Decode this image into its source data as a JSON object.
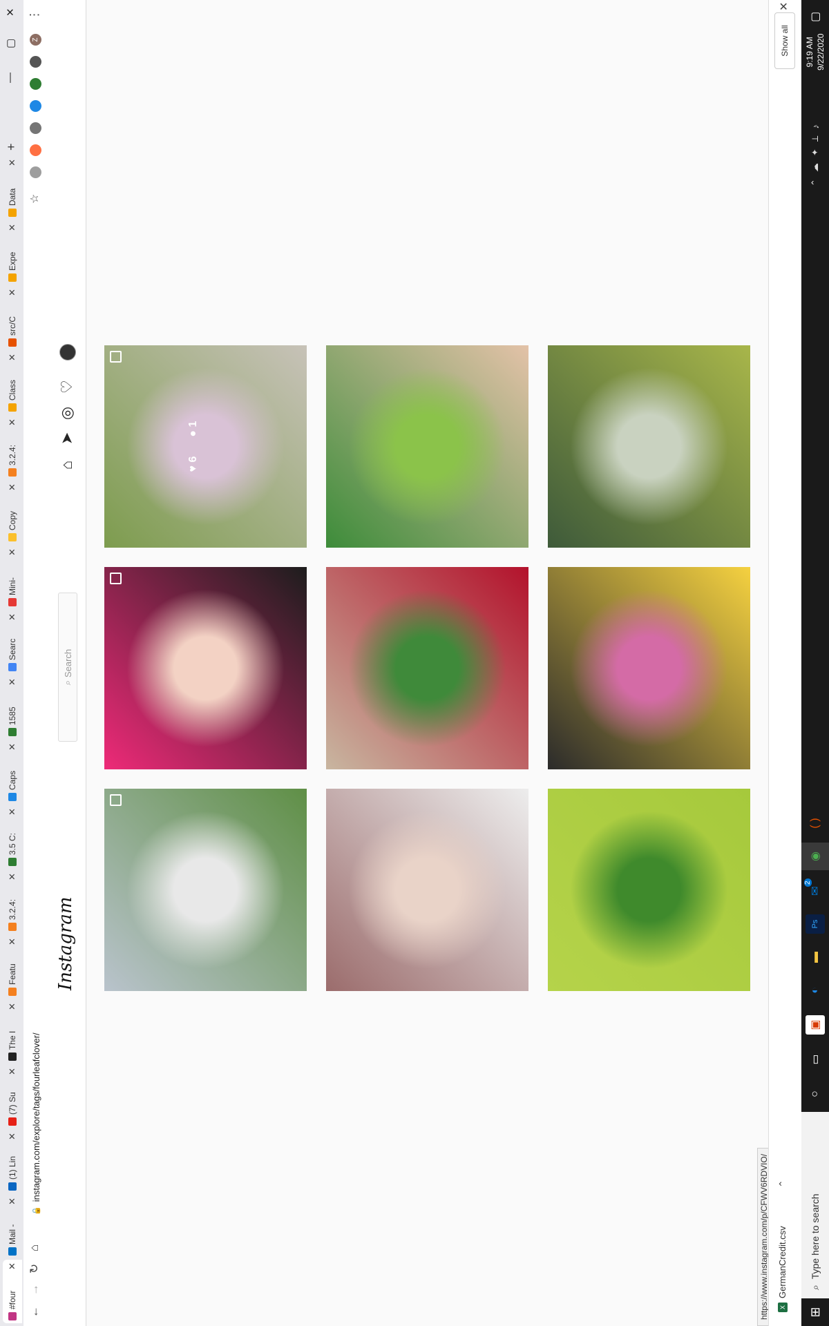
{
  "browser": {
    "tabs": [
      {
        "title": "#four",
        "favicon_color": "#c13584",
        "active": true
      },
      {
        "title": "Mail -",
        "favicon_color": "#0072c6"
      },
      {
        "title": "(1) Lin",
        "favicon_color": "#0a66c2"
      },
      {
        "title": "(7) Su",
        "favicon_color": "#e62117"
      },
      {
        "title": "The I",
        "favicon_color": "#222222"
      },
      {
        "title": "Featu",
        "favicon_color": "#f4801f"
      },
      {
        "title": "3.2.4:",
        "favicon_color": "#f4801f"
      },
      {
        "title": "3.5 C:",
        "favicon_color": "#2e7d32"
      },
      {
        "title": "Caps",
        "favicon_color": "#1e88e5"
      },
      {
        "title": "1585",
        "favicon_color": "#2e7d32"
      },
      {
        "title": "Searc",
        "favicon_color": "#4285f4"
      },
      {
        "title": "Mini-",
        "favicon_color": "#e53935"
      },
      {
        "title": "Copy",
        "favicon_color": "#fbc02d"
      },
      {
        "title": "3.2.4:",
        "favicon_color": "#f4801f"
      },
      {
        "title": "Class",
        "favicon_color": "#f4a300"
      },
      {
        "title": "src/C",
        "favicon_color": "#e65100"
      },
      {
        "title": "Expe",
        "favicon_color": "#f4a300"
      },
      {
        "title": "Data",
        "favicon_color": "#f4a300"
      }
    ],
    "new_tab_symbol": "+",
    "url": "instagram.com/explore/tags/fourleafclover/",
    "status_url": "https://www.instagram.com/p/CFWV6RDVIO/",
    "extensions": [
      {
        "label": "",
        "color": "#9e9e9e"
      },
      {
        "label": "",
        "color": "#ff7043"
      },
      {
        "label": "",
        "color": "#757575"
      },
      {
        "label": "",
        "color": "#1e88e5"
      },
      {
        "label": "",
        "color": "#2e7d32"
      },
      {
        "label": "",
        "color": "#555555"
      },
      {
        "label": "Z",
        "color": "#8d6e63"
      }
    ]
  },
  "instagram": {
    "logo": "Instagram",
    "search_placeholder": "Search",
    "posts": [
      {
        "colors": [
          "#b9c3cc",
          "#e8e8e8",
          "#5f8f46"
        ],
        "multi": true
      },
      {
        "colors": [
          "#ee2a78",
          "#f3d2c4",
          "#1d1d1d"
        ],
        "multi": true
      },
      {
        "colors": [
          "#7d9c4e",
          "#d9c2d6",
          "#c7c2b8"
        ],
        "multi": true,
        "likes": "6",
        "comments": "1"
      },
      {
        "colors": [
          "#9b6c6c",
          "#e9d3c8",
          "#ededed"
        ],
        "multi": false
      },
      {
        "colors": [
          "#c8b6a0",
          "#3f8a3a",
          "#b3122c"
        ],
        "multi": false
      },
      {
        "colors": [
          "#3d8c3a",
          "#8bc34a",
          "#e3c2a8"
        ],
        "multi": false
      },
      {
        "colors": [
          "#b5d34a",
          "#3f8a2c",
          "#a6c93c"
        ],
        "multi": false
      },
      {
        "colors": [
          "#2b2b2b",
          "#d46ba6",
          "#f5d140"
        ],
        "multi": false
      },
      {
        "colors": [
          "#3e5a3a",
          "#c9d2c0",
          "#a8b64a"
        ],
        "multi": false
      }
    ]
  },
  "downloads": {
    "file_name": "GermanCredit.csv",
    "show_all": "Show all"
  },
  "taskbar": {
    "search_placeholder": "Type here to search",
    "mail_badge": "2",
    "time": "9:19 AM",
    "date": "9/22/2020"
  }
}
